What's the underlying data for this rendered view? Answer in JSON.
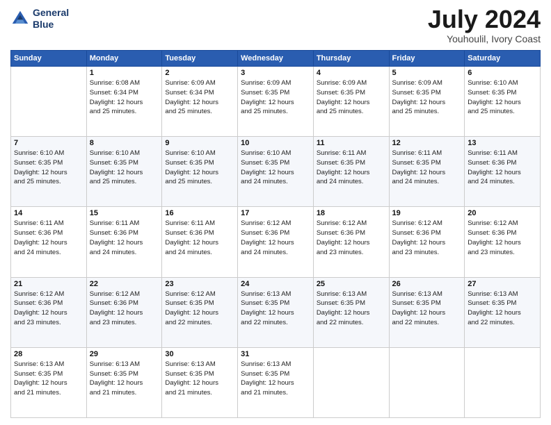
{
  "header": {
    "logo_line1": "General",
    "logo_line2": "Blue",
    "month": "July 2024",
    "location": "Youhoulil, Ivory Coast"
  },
  "weekdays": [
    "Sunday",
    "Monday",
    "Tuesday",
    "Wednesday",
    "Thursday",
    "Friday",
    "Saturday"
  ],
  "weeks": [
    [
      {
        "day": "",
        "info": ""
      },
      {
        "day": "1",
        "info": "Sunrise: 6:08 AM\nSunset: 6:34 PM\nDaylight: 12 hours\nand 25 minutes."
      },
      {
        "day": "2",
        "info": "Sunrise: 6:09 AM\nSunset: 6:34 PM\nDaylight: 12 hours\nand 25 minutes."
      },
      {
        "day": "3",
        "info": "Sunrise: 6:09 AM\nSunset: 6:35 PM\nDaylight: 12 hours\nand 25 minutes."
      },
      {
        "day": "4",
        "info": "Sunrise: 6:09 AM\nSunset: 6:35 PM\nDaylight: 12 hours\nand 25 minutes."
      },
      {
        "day": "5",
        "info": "Sunrise: 6:09 AM\nSunset: 6:35 PM\nDaylight: 12 hours\nand 25 minutes."
      },
      {
        "day": "6",
        "info": "Sunrise: 6:10 AM\nSunset: 6:35 PM\nDaylight: 12 hours\nand 25 minutes."
      }
    ],
    [
      {
        "day": "7",
        "info": "Sunrise: 6:10 AM\nSunset: 6:35 PM\nDaylight: 12 hours\nand 25 minutes."
      },
      {
        "day": "8",
        "info": "Sunrise: 6:10 AM\nSunset: 6:35 PM\nDaylight: 12 hours\nand 25 minutes."
      },
      {
        "day": "9",
        "info": "Sunrise: 6:10 AM\nSunset: 6:35 PM\nDaylight: 12 hours\nand 25 minutes."
      },
      {
        "day": "10",
        "info": "Sunrise: 6:10 AM\nSunset: 6:35 PM\nDaylight: 12 hours\nand 24 minutes."
      },
      {
        "day": "11",
        "info": "Sunrise: 6:11 AM\nSunset: 6:35 PM\nDaylight: 12 hours\nand 24 minutes."
      },
      {
        "day": "12",
        "info": "Sunrise: 6:11 AM\nSunset: 6:35 PM\nDaylight: 12 hours\nand 24 minutes."
      },
      {
        "day": "13",
        "info": "Sunrise: 6:11 AM\nSunset: 6:36 PM\nDaylight: 12 hours\nand 24 minutes."
      }
    ],
    [
      {
        "day": "14",
        "info": "Sunrise: 6:11 AM\nSunset: 6:36 PM\nDaylight: 12 hours\nand 24 minutes."
      },
      {
        "day": "15",
        "info": "Sunrise: 6:11 AM\nSunset: 6:36 PM\nDaylight: 12 hours\nand 24 minutes."
      },
      {
        "day": "16",
        "info": "Sunrise: 6:11 AM\nSunset: 6:36 PM\nDaylight: 12 hours\nand 24 minutes."
      },
      {
        "day": "17",
        "info": "Sunrise: 6:12 AM\nSunset: 6:36 PM\nDaylight: 12 hours\nand 24 minutes."
      },
      {
        "day": "18",
        "info": "Sunrise: 6:12 AM\nSunset: 6:36 PM\nDaylight: 12 hours\nand 23 minutes."
      },
      {
        "day": "19",
        "info": "Sunrise: 6:12 AM\nSunset: 6:36 PM\nDaylight: 12 hours\nand 23 minutes."
      },
      {
        "day": "20",
        "info": "Sunrise: 6:12 AM\nSunset: 6:36 PM\nDaylight: 12 hours\nand 23 minutes."
      }
    ],
    [
      {
        "day": "21",
        "info": "Sunrise: 6:12 AM\nSunset: 6:36 PM\nDaylight: 12 hours\nand 23 minutes."
      },
      {
        "day": "22",
        "info": "Sunrise: 6:12 AM\nSunset: 6:36 PM\nDaylight: 12 hours\nand 23 minutes."
      },
      {
        "day": "23",
        "info": "Sunrise: 6:12 AM\nSunset: 6:35 PM\nDaylight: 12 hours\nand 22 minutes."
      },
      {
        "day": "24",
        "info": "Sunrise: 6:13 AM\nSunset: 6:35 PM\nDaylight: 12 hours\nand 22 minutes."
      },
      {
        "day": "25",
        "info": "Sunrise: 6:13 AM\nSunset: 6:35 PM\nDaylight: 12 hours\nand 22 minutes."
      },
      {
        "day": "26",
        "info": "Sunrise: 6:13 AM\nSunset: 6:35 PM\nDaylight: 12 hours\nand 22 minutes."
      },
      {
        "day": "27",
        "info": "Sunrise: 6:13 AM\nSunset: 6:35 PM\nDaylight: 12 hours\nand 22 minutes."
      }
    ],
    [
      {
        "day": "28",
        "info": "Sunrise: 6:13 AM\nSunset: 6:35 PM\nDaylight: 12 hours\nand 21 minutes."
      },
      {
        "day": "29",
        "info": "Sunrise: 6:13 AM\nSunset: 6:35 PM\nDaylight: 12 hours\nand 21 minutes."
      },
      {
        "day": "30",
        "info": "Sunrise: 6:13 AM\nSunset: 6:35 PM\nDaylight: 12 hours\nand 21 minutes."
      },
      {
        "day": "31",
        "info": "Sunrise: 6:13 AM\nSunset: 6:35 PM\nDaylight: 12 hours\nand 21 minutes."
      },
      {
        "day": "",
        "info": ""
      },
      {
        "day": "",
        "info": ""
      },
      {
        "day": "",
        "info": ""
      }
    ]
  ]
}
